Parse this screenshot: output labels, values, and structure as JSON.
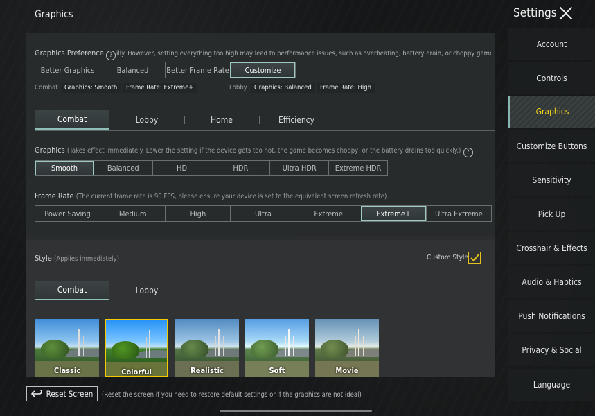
{
  "header": {
    "page_title": "Graphics",
    "settings_title": "Settings"
  },
  "graphics_preference": {
    "label": "Graphics Preference",
    "description": "illy. However, setting everything too high may lead to performance issues, such as overheating, battery drain, or choppy gameplay",
    "options": [
      "Better Graphics",
      "Balanced",
      "Better Frame Rate",
      "Customize"
    ],
    "selected": "Customize",
    "combat_label": "Combat",
    "combat_chips": [
      "Graphics: Smooth",
      "Frame Rate: Extreme+"
    ],
    "lobby_label": "Lobby",
    "lobby_chips": [
      "Graphics: Balanced",
      "Frame Rate: High"
    ]
  },
  "mode_tabs": {
    "items": [
      "Combat",
      "Lobby",
      "Home",
      "Efficiency"
    ],
    "selected": "Combat"
  },
  "graphics": {
    "label": "Graphics",
    "note": "(Takes effect immediately. Lower the setting if the device gets too hot, the game becomes choppy, or the battery drains too quickly.)",
    "options": [
      "Smooth",
      "Balanced",
      "HD",
      "HDR",
      "Ultra HDR",
      "Extreme HDR"
    ],
    "selected": "Smooth"
  },
  "frame_rate": {
    "label": "Frame Rate",
    "note": "(The current frame rate is 90 FPS, please ensure your device is set to the equivalent screen refresh rate)",
    "options": [
      "Power Saving",
      "Medium",
      "High",
      "Ultra",
      "Extreme",
      "Extreme+",
      "Ultra Extreme"
    ],
    "selected": "Extreme+"
  },
  "style": {
    "label": "Style",
    "note": "(Applies immediately)",
    "custom_style_label": "Custom Style",
    "custom_style_checked": true,
    "tabs": [
      "Combat",
      "Lobby"
    ],
    "selected_tab": "Combat",
    "presets": [
      "Classic",
      "Colorful",
      "Realistic",
      "Soft",
      "Movie"
    ],
    "selected_preset": "Colorful"
  },
  "footer": {
    "reset_label": "Reset Screen",
    "reset_note": "(Reset the screen if you need to restore default settings or if the graphics are not ideal)"
  },
  "sidebar": {
    "items": [
      "Account",
      "Controls",
      "Graphics",
      "Customize Buttons",
      "Sensitivity",
      "Pick Up",
      "Crosshair & Effects",
      "Audio & Haptics",
      "Push Notifications",
      "Privacy & Social",
      "Language"
    ],
    "selected": "Graphics"
  },
  "colors": {
    "accent_yellow": "#f3d21c",
    "accent_teal": "#8ec0b9"
  }
}
